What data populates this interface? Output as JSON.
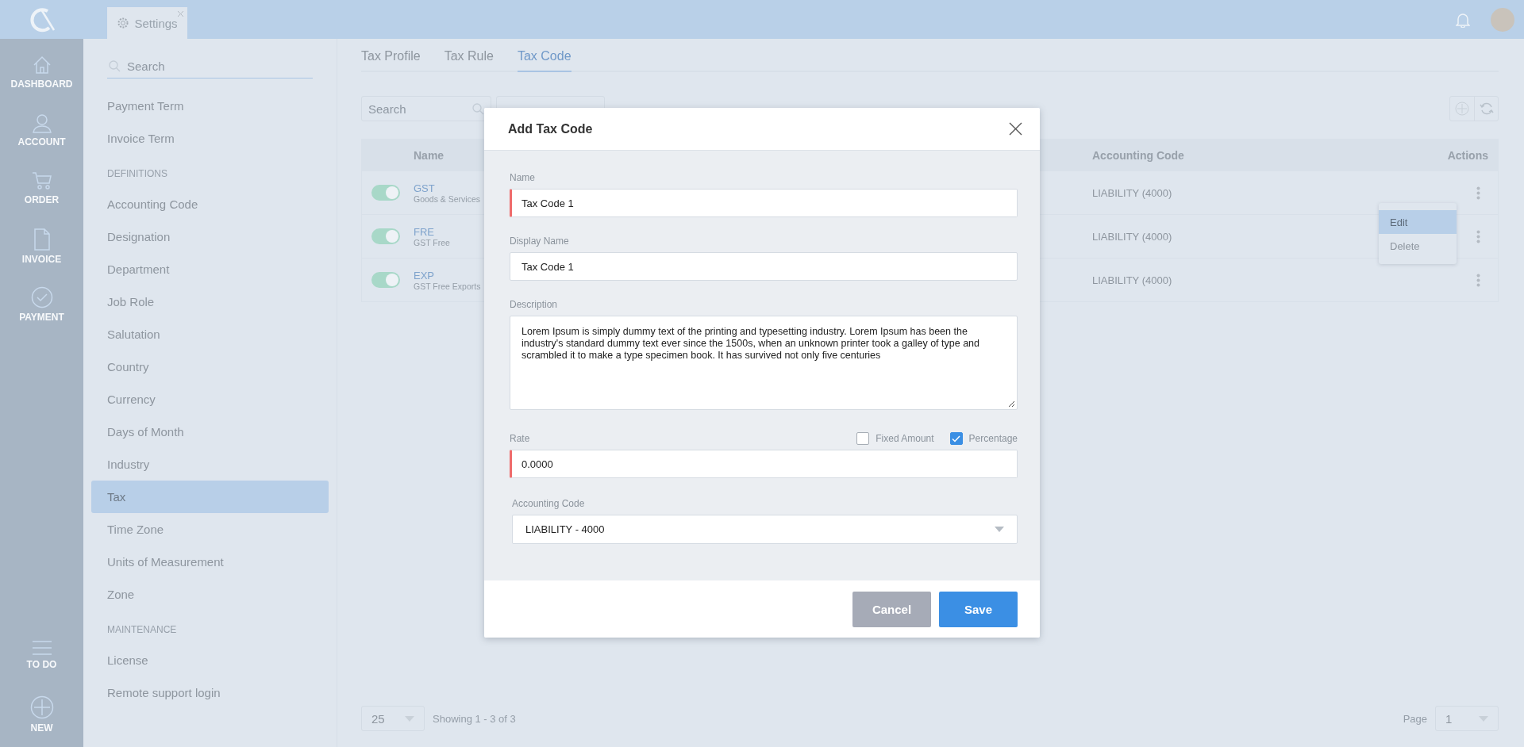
{
  "app_bar": {
    "tabs": [
      {
        "label": "Settings",
        "selected": true
      }
    ]
  },
  "nav_rail": {
    "items": [
      {
        "label": "DASHBOARD"
      },
      {
        "label": "ACCOUNT"
      },
      {
        "label": "ORDER"
      },
      {
        "label": "INVOICE"
      },
      {
        "label": "PAYMENT"
      }
    ],
    "bottom_items": [
      {
        "label": "TO DO"
      },
      {
        "label": "NEW"
      }
    ]
  },
  "settings_menu": {
    "search_placeholder": "Search",
    "sections": [
      {
        "items": [
          {
            "label": "Payment Term",
            "selected": false
          },
          {
            "label": "Invoice Term",
            "selected": false
          }
        ]
      },
      {
        "header": "DEFINITIONS",
        "items": [
          {
            "label": "Accounting Code",
            "selected": false
          },
          {
            "label": "Designation",
            "selected": false
          },
          {
            "label": "Department",
            "selected": false
          },
          {
            "label": "Job Role",
            "selected": false
          },
          {
            "label": "Salutation",
            "selected": false
          },
          {
            "label": "Country",
            "selected": false
          },
          {
            "label": "Currency",
            "selected": false
          },
          {
            "label": "Days of Month",
            "selected": false
          },
          {
            "label": "Industry",
            "selected": false
          },
          {
            "label": "Tax",
            "selected": true
          },
          {
            "label": "Time Zone",
            "selected": false
          },
          {
            "label": "Units of Measurement",
            "selected": false
          },
          {
            "label": "Zone",
            "selected": false
          }
        ]
      },
      {
        "header": "MAINTENANCE",
        "items": [
          {
            "label": "License",
            "selected": false
          },
          {
            "label": "Remote support login",
            "selected": false
          }
        ]
      }
    ]
  },
  "tabs": [
    {
      "label": "Tax Profile",
      "selected": false
    },
    {
      "label": "Tax Rule",
      "selected": false
    },
    {
      "label": "Tax Code",
      "selected": true
    }
  ],
  "toolbar": {
    "search_placeholder": "Search"
  },
  "table": {
    "columns": [
      "Name",
      "Accounting Code",
      "Actions"
    ],
    "rows": [
      {
        "enabled": true,
        "code": "GST",
        "description": "Goods & Services",
        "accounting_code": "LIABILITY (4000)"
      },
      {
        "enabled": true,
        "code": "FRE",
        "description": "GST Free",
        "accounting_code": "LIABILITY (4000)"
      },
      {
        "enabled": true,
        "code": "EXP",
        "description": "GST Free Exports",
        "accounting_code": "LIABILITY (4000)"
      }
    ]
  },
  "context_menu": {
    "items": [
      {
        "label": "Edit",
        "selected": true
      },
      {
        "label": "Delete",
        "selected": false
      }
    ]
  },
  "pagination": {
    "page_size": "25",
    "summary": "Showing 1 - 3 of 3",
    "page_label": "Page",
    "page": "1"
  },
  "modal": {
    "title": "Add Tax Code",
    "fields": [
      {
        "kind": "text",
        "label": "Name",
        "value": "Tax Code 1",
        "required": true
      },
      {
        "kind": "text",
        "label": "Display Name",
        "value": "Tax Code 1",
        "required": false
      },
      {
        "kind": "textarea",
        "label": "Description",
        "value": "Lorem Ipsum is simply dummy text of the printing and typesetting industry. Lorem Ipsum has been the industry's standard dummy text ever since the 1500s, when an unknown printer took a galley of type and scrambled it to make a type specimen book. It has survived not only five centuries",
        "required": false
      },
      {
        "kind": "rate",
        "label": "Rate",
        "value": "0.0000",
        "required": true,
        "options": [
          {
            "label": "Fixed Amount",
            "checked": false
          },
          {
            "label": "Percentage",
            "checked": true
          }
        ]
      },
      {
        "kind": "select",
        "label": "Accounting Code",
        "value": "LIABILITY - 4000",
        "required": false
      }
    ],
    "buttons": [
      {
        "label": "Cancel",
        "kind": "secondary"
      },
      {
        "label": "Save",
        "kind": "primary"
      }
    ]
  }
}
